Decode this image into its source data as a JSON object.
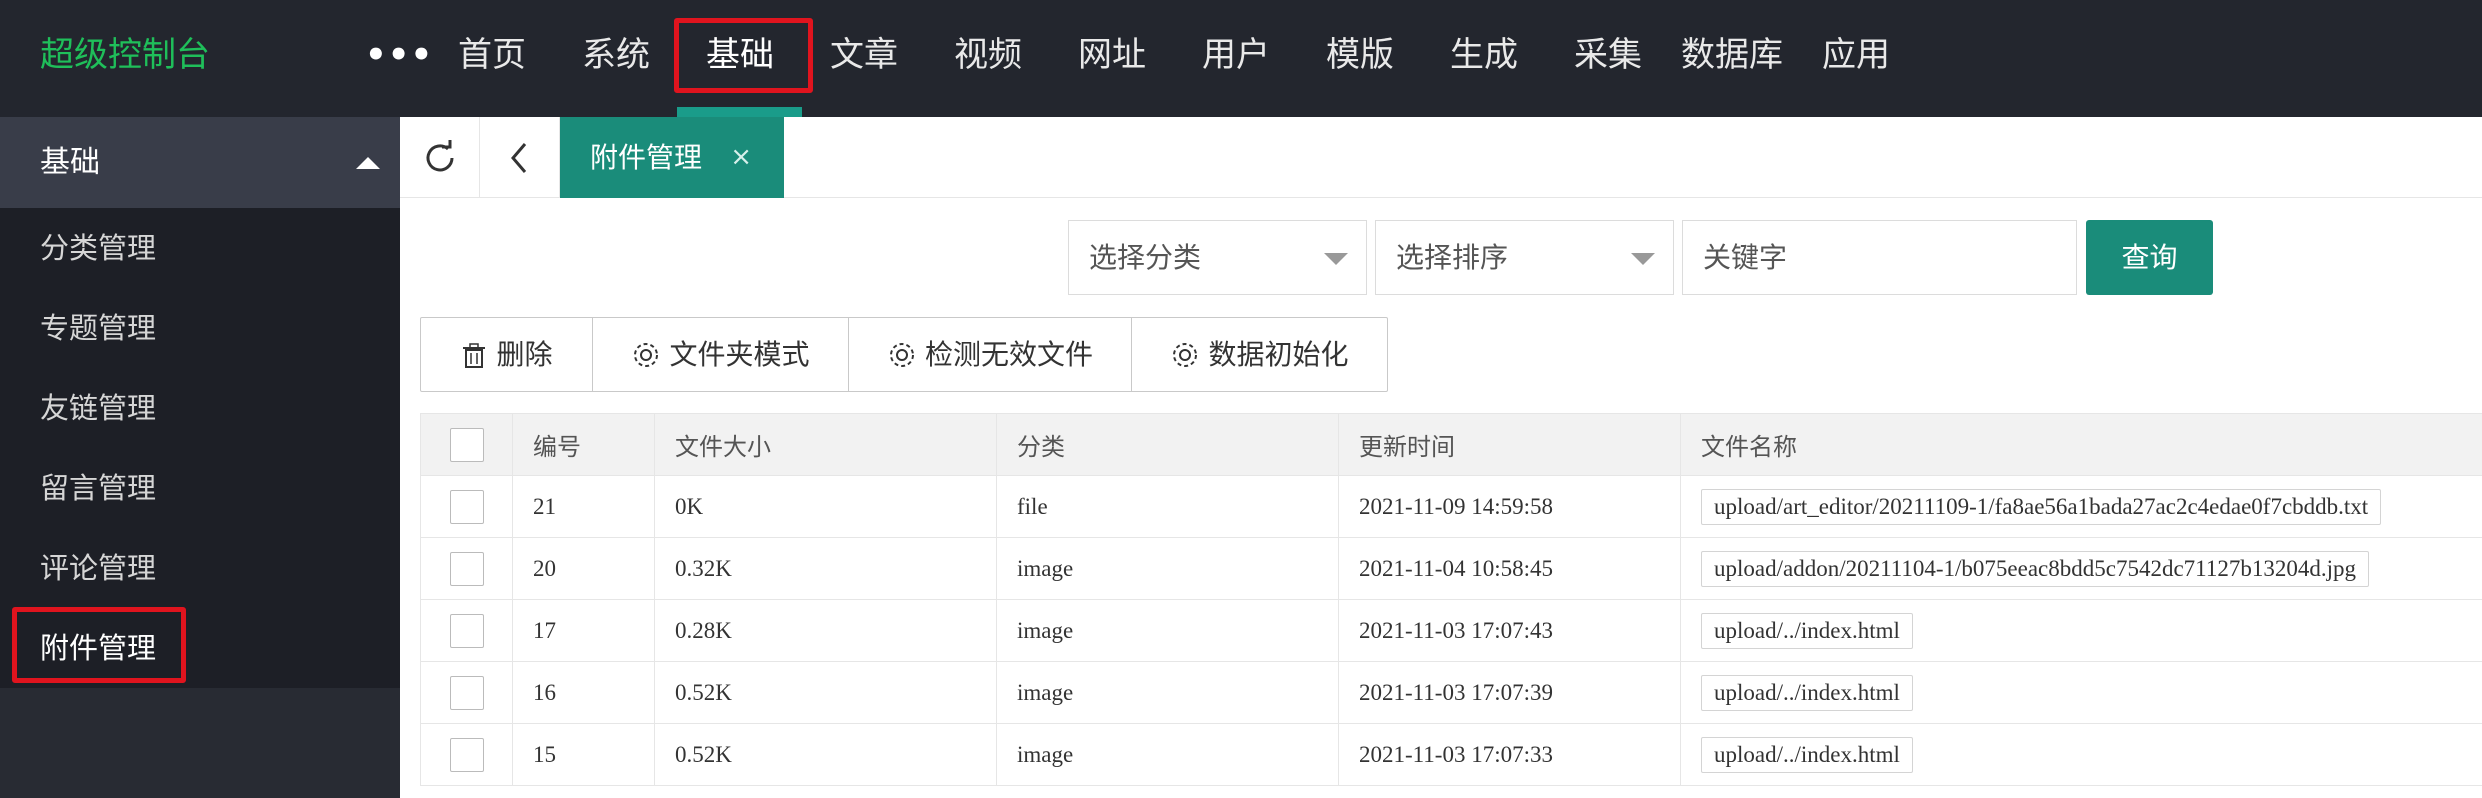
{
  "app": {
    "title": "超级控制台",
    "more": "•••"
  },
  "nav": {
    "items": [
      {
        "label": "首页"
      },
      {
        "label": "系统"
      },
      {
        "label": "基础"
      },
      {
        "label": "文章"
      },
      {
        "label": "视频"
      },
      {
        "label": "网址"
      },
      {
        "label": "用户"
      },
      {
        "label": "模版"
      },
      {
        "label": "生成"
      },
      {
        "label": "采集"
      },
      {
        "label": "数据库"
      },
      {
        "label": "应用"
      }
    ],
    "active": "基础"
  },
  "sidebar": {
    "group": "基础",
    "items": [
      {
        "label": "分类管理"
      },
      {
        "label": "专题管理"
      },
      {
        "label": "友链管理"
      },
      {
        "label": "留言管理"
      },
      {
        "label": "评论管理"
      },
      {
        "label": "附件管理"
      }
    ],
    "active": "附件管理"
  },
  "tabs": {
    "active_label": "附件管理",
    "close": "×"
  },
  "filters": {
    "category_placeholder": "选择分类",
    "sort_placeholder": "选择排序",
    "keyword_placeholder": "关键字",
    "query_label": "查询"
  },
  "toolbar": {
    "delete_label": "删除",
    "folder_mode_label": "文件夹模式",
    "detect_invalid_label": "检测无效文件",
    "init_data_label": "数据初始化"
  },
  "table": {
    "headers": [
      "编号",
      "文件大小",
      "分类",
      "更新时间",
      "文件名称"
    ],
    "rows": [
      {
        "id": "21",
        "size": "0K",
        "type": "file",
        "time": "2021-11-09 14:59:58",
        "name": "upload/art_editor/20211109-1/fa8ae56a1bada27ac2c4edae0f7cbddb.txt"
      },
      {
        "id": "20",
        "size": "0.32K",
        "type": "image",
        "time": "2021-11-04 10:58:45",
        "name": "upload/addon/20211104-1/b075eeac8bdd5c7542dc71127b13204d.jpg"
      },
      {
        "id": "17",
        "size": "0.28K",
        "type": "image",
        "time": "2021-11-03 17:07:43",
        "name": "upload/../index.html"
      },
      {
        "id": "16",
        "size": "0.52K",
        "type": "image",
        "time": "2021-11-03 17:07:39",
        "name": "upload/../index.html"
      },
      {
        "id": "15",
        "size": "0.52K",
        "type": "image",
        "time": "2021-11-03 17:07:33",
        "name": "upload/../index.html"
      }
    ]
  },
  "colors": {
    "accent": "#1a8c7a",
    "highlight": "#e0141e",
    "logo": "#1fbf5a"
  }
}
